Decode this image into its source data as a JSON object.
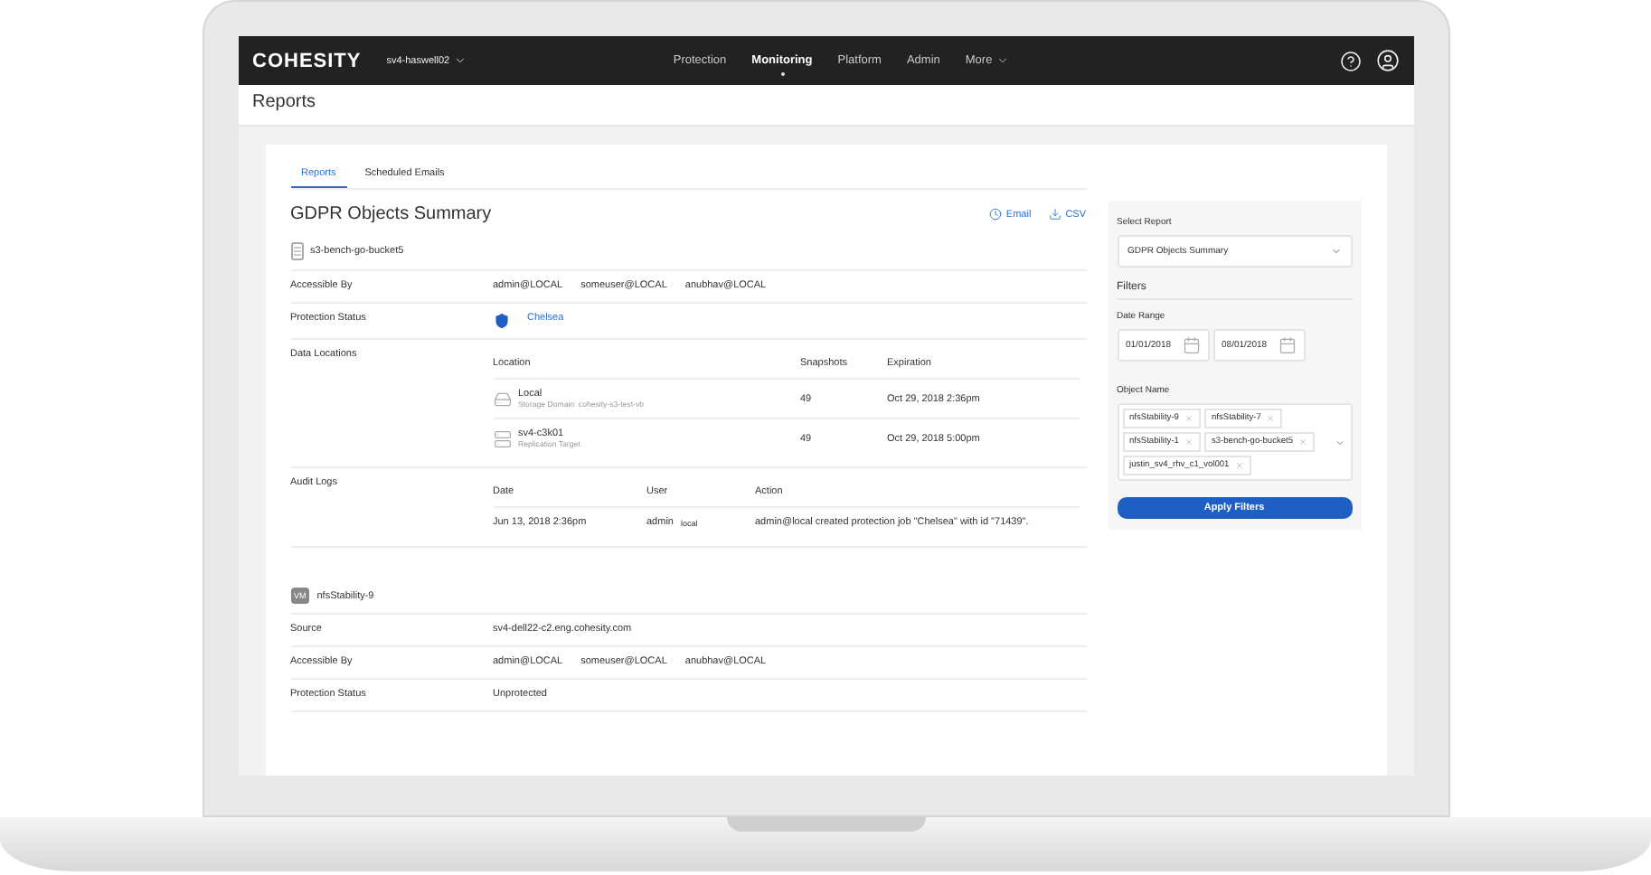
{
  "navbar": {
    "brand": "COHESITY",
    "cluster": "sv4-haswell02",
    "items": [
      {
        "label": "Protection",
        "selected": false,
        "dropdown": false
      },
      {
        "label": "Monitoring",
        "selected": true,
        "dropdown": false
      },
      {
        "label": "Platform",
        "selected": false,
        "dropdown": false
      },
      {
        "label": "Admin",
        "selected": false,
        "dropdown": false
      },
      {
        "label": "More",
        "selected": false,
        "dropdown": true
      }
    ]
  },
  "page_title": "Reports",
  "tabs": [
    {
      "label": "Reports",
      "selected": true
    },
    {
      "label": "Scheduled Emails",
      "selected": false
    }
  ],
  "report": {
    "title": "GDPR Objects Summary",
    "actions": [
      {
        "label": "Email",
        "kind": "clock"
      },
      {
        "label": "CSV",
        "kind": "download"
      }
    ],
    "objects": [
      {
        "name": "s3-bench-go-bucket5",
        "kind": "bucket",
        "fields": [
          {
            "label": "Accessible By",
            "kind": "users",
            "values": [
              "admin@LOCAL",
              "someuser@LOCAL",
              "anubhav@LOCAL"
            ]
          },
          {
            "label": "Protection Status",
            "kind": "protected",
            "value": "Chelsea"
          },
          {
            "label": "Data Locations",
            "kind": "locations",
            "columns": [
              "Location",
              "Snapshots",
              "Expiration"
            ],
            "rows": [
              {
                "kind": "local",
                "title": "Local",
                "subtitle": "Storage Domain: cohesity-s3-test-vb",
                "snapshots": "49",
                "expiration": "Oct 29, 2018 2:36pm"
              },
              {
                "kind": "replication",
                "title": "sv4-c3k01",
                "subtitle": "Replication Target",
                "snapshots": "49",
                "expiration": "Oct 29, 2018 5:00pm"
              }
            ]
          },
          {
            "label": "Audit Logs",
            "kind": "audit",
            "columns": [
              "Date",
              "User",
              "Action"
            ],
            "rows": [
              {
                "date": "Jun 13, 2018 2:36pm",
                "user": "admin",
                "domain": "local",
                "action": "admin@local created protection job \"Chelsea\" with id \"71439\"."
              }
            ]
          }
        ]
      },
      {
        "name": "nfsStability-9",
        "kind": "vm",
        "badge": "VM",
        "fields": [
          {
            "label": "Source",
            "kind": "text",
            "value": "sv4-dell22-c2.eng.cohesity.com"
          },
          {
            "label": "Accessible By",
            "kind": "users",
            "values": [
              "admin@LOCAL",
              "someuser@LOCAL",
              "anubhav@LOCAL"
            ]
          },
          {
            "label": "Protection Status",
            "kind": "text",
            "value": "Unprotected"
          }
        ]
      }
    ]
  },
  "sidebar": {
    "select_label": "Select Report",
    "select_value": "GDPR Objects Summary",
    "filters_title": "Filters",
    "date_label": "Date Range",
    "date_from": "01/01/2018",
    "date_to": "08/01/2018",
    "object_label": "Object Name",
    "object_tags": [
      "nfsStability-9",
      "nfsStability-7",
      "nfsStability-1",
      "s3-bench-go-bucket5",
      "justin_sv4_rhv_c1_vol001"
    ],
    "apply_label": "Apply Filters"
  }
}
